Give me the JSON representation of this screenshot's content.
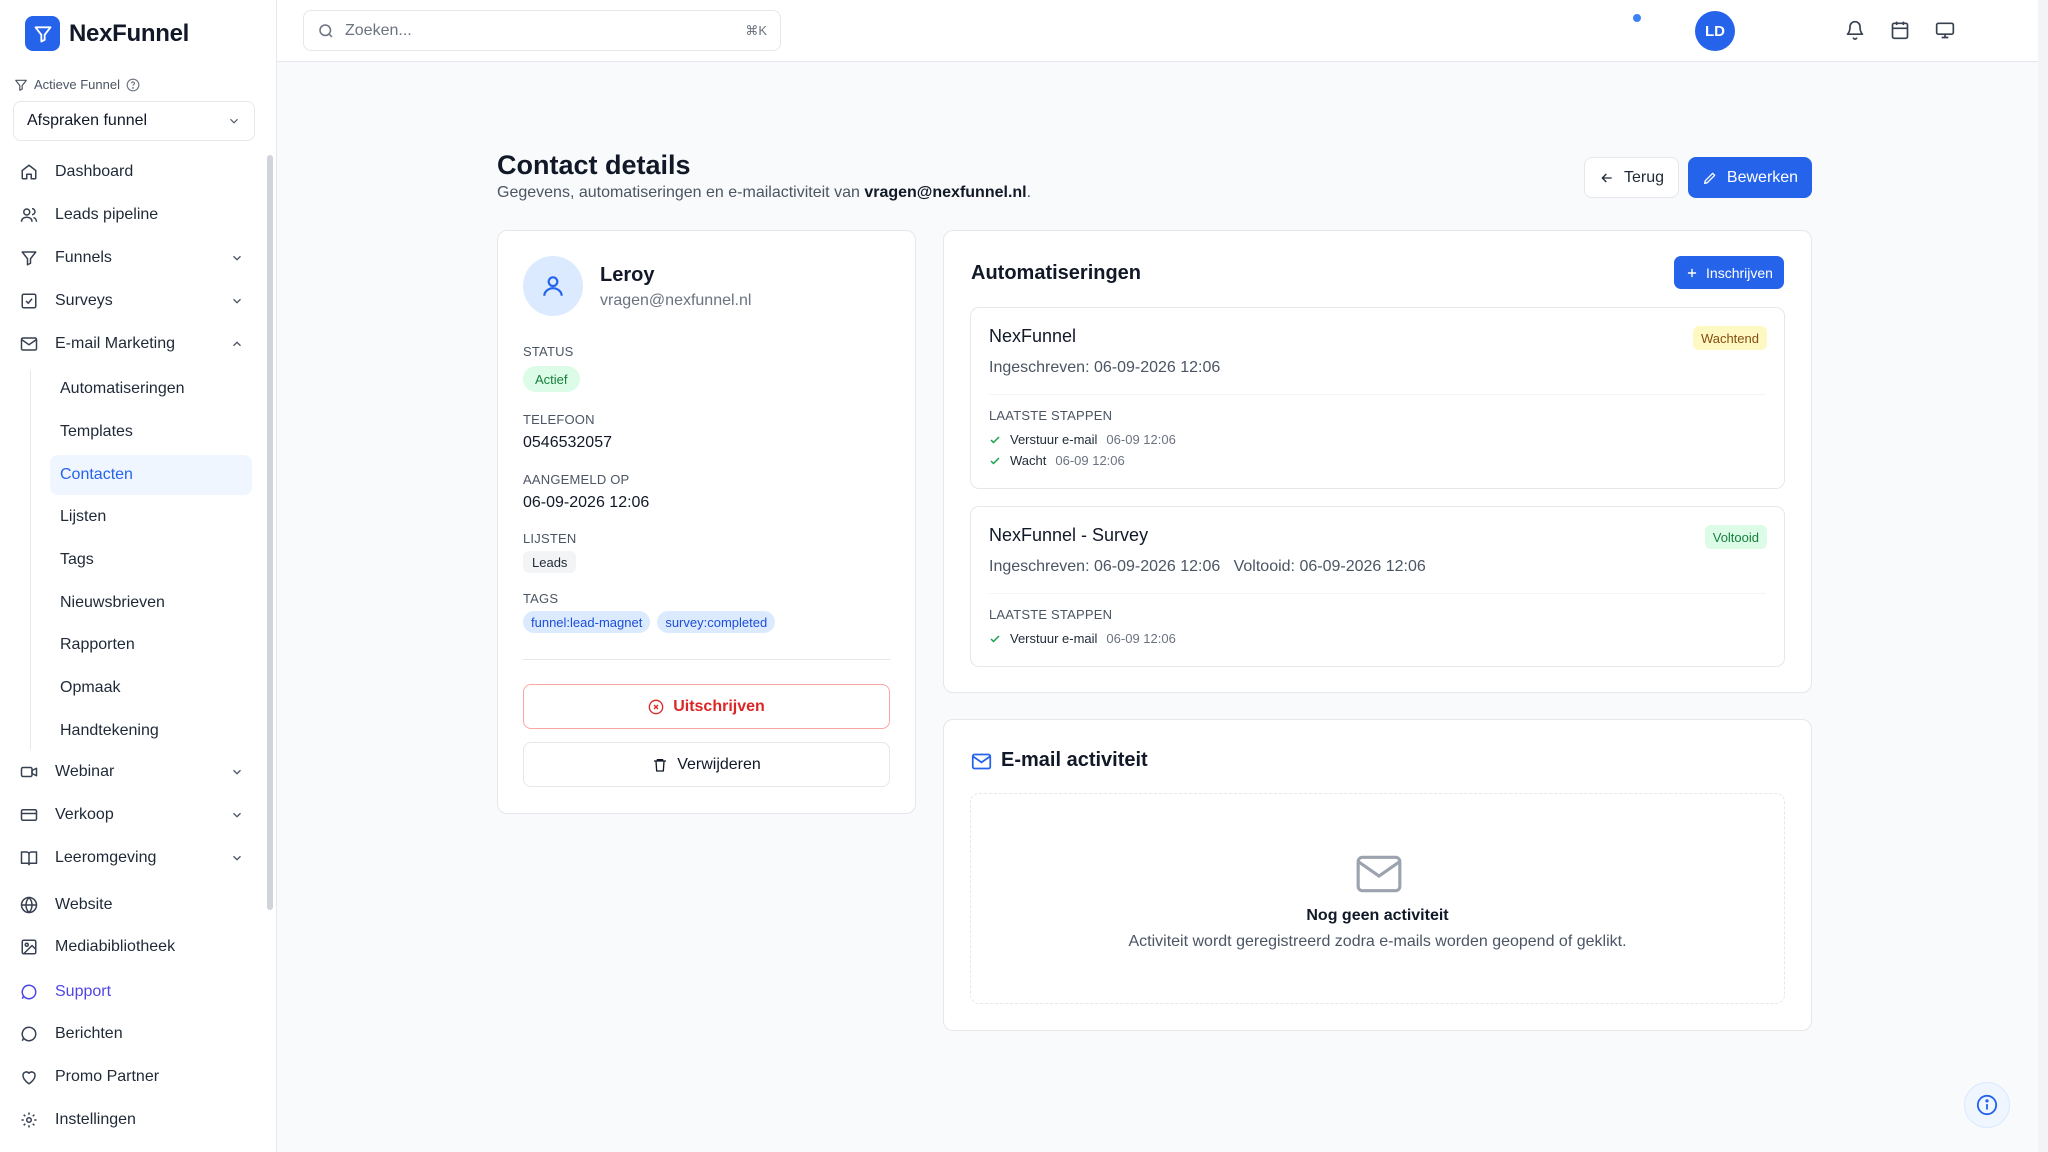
{
  "app": {
    "brand": "NexFunnel"
  },
  "sidebar": {
    "active_funnel_label": "Actieve Funnel",
    "active_funnel_value": "Afspraken funnel",
    "items": [
      {
        "label": "Dashboard",
        "icon": "home-icon"
      },
      {
        "label": "Leads pipeline",
        "icon": "users-icon"
      },
      {
        "label": "Funnels",
        "icon": "funnel-icon"
      },
      {
        "label": "Surveys",
        "icon": "checkbox-icon"
      },
      {
        "label": "E-mail Marketing",
        "icon": "mail-icon"
      },
      {
        "label": "Webinar",
        "icon": "video-icon"
      },
      {
        "label": "Verkoop",
        "icon": "credit-card-icon"
      },
      {
        "label": "Leeromgeving",
        "icon": "book-icon"
      },
      {
        "label": "Website",
        "icon": "globe-icon"
      },
      {
        "label": "Mediabibliotheek",
        "icon": "image-icon"
      },
      {
        "label": "Support",
        "icon": "chat-icon"
      },
      {
        "label": "Berichten",
        "icon": "message-icon"
      },
      {
        "label": "Promo Partner",
        "icon": "heart-icon"
      },
      {
        "label": "Instellingen",
        "icon": "gear-icon"
      }
    ],
    "email_sub": [
      "Automatiseringen",
      "Templates",
      "Contacten",
      "Lijsten",
      "Tags",
      "Nieuwsbrieven",
      "Rapporten",
      "Opmaak",
      "Handtekening"
    ],
    "active_sub": "Contacten"
  },
  "topbar": {
    "search_placeholder": "Zoeken...",
    "search_shortcut": "⌘K",
    "avatar_initials": "LD"
  },
  "page": {
    "title": "Contact details",
    "subtitle_prefix": "Gegevens, automatiseringen en e-mailactiviteit van ",
    "subtitle_email": "vragen@nexfunnel.nl",
    "subtitle_suffix": ".",
    "back_label": "Terug",
    "edit_label": "Bewerken"
  },
  "contact": {
    "name": "Leroy",
    "email": "vragen@nexfunnel.nl",
    "status_label": "STATUS",
    "status_value": "Actief",
    "phone_label": "TELEFOON",
    "phone_value": "0546532057",
    "registered_label": "AANGEMELD OP",
    "registered_value": "06-09-2026 12:06",
    "lists_label": "LIJSTEN",
    "lists": [
      "Leads"
    ],
    "tags_label": "TAGS",
    "tags": [
      "funnel:lead-magnet",
      "survey:completed"
    ],
    "unsubscribe_label": "Uitschrijven",
    "delete_label": "Verwijderen"
  },
  "automations": {
    "title": "Automatiseringen",
    "enroll_label": "Inschrijven",
    "steps_label": "LAATSTE STAPPEN",
    "items": [
      {
        "name": "NexFunnel",
        "status": "Wachtend",
        "meta": "Ingeschreven: 06-09-2026 12:06",
        "steps": [
          {
            "name": "Verstuur e-mail",
            "time": "06-09 12:06"
          },
          {
            "name": "Wacht",
            "time": "06-09 12:06"
          }
        ]
      },
      {
        "name": "NexFunnel - Survey",
        "status": "Voltooid",
        "meta": "Ingeschreven: 06-09-2026 12:06   Voltooid: 06-09-2026 12:06",
        "steps": [
          {
            "name": "Verstuur e-mail",
            "time": "06-09 12:06"
          }
        ]
      }
    ]
  },
  "email_activity": {
    "title": "E-mail activiteit",
    "empty_title": "Nog geen activiteit",
    "empty_text": "Activiteit wordt geregistreerd zodra e-mails worden geopend of geklikt."
  },
  "colors": {
    "accent": "#2563eb",
    "success": "#15803d",
    "warning": "#854d0e",
    "danger": "#dc2626"
  }
}
